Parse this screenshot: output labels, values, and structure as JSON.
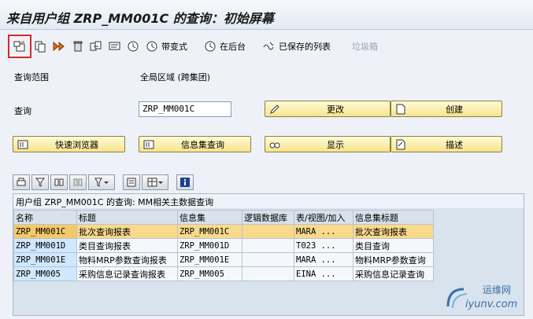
{
  "window": {
    "title": "来自用户组 ZRP_MM001C 的查询：初始屏幕"
  },
  "toolbar": {
    "items": [
      {
        "icon": "new-window-icon"
      },
      {
        "icon": "copy-icon"
      },
      {
        "icon": "execute-icon"
      },
      {
        "icon": "delete-icon"
      },
      {
        "icon": "copy-objects-icon"
      },
      {
        "icon": "description-icon"
      },
      {
        "icon": "execute-clock-icon"
      },
      {
        "icon": "variant-clock-icon",
        "label": "带变式"
      },
      {
        "icon": "background-clock-icon",
        "label": "在后台"
      },
      {
        "icon": "saved-lists-icon",
        "label": "已保存的列表"
      },
      {
        "label": "垃圾箱",
        "disabled": true
      }
    ]
  },
  "form": {
    "query_area_label": "查询范围",
    "query_area_value": "全局区域 (跨集团)",
    "query_label": "查询",
    "query_value": "ZRP_MM001C"
  },
  "buttons": {
    "change": "更改",
    "create": "创建",
    "quick_viewer": "快速浏览器",
    "infoset_query": "信息集查询",
    "display": "显示",
    "description": "描述"
  },
  "grid": {
    "caption": "用户组 ZRP_MM001C 的查询: MM相关主数据查询",
    "columns": [
      "名称",
      "标题",
      "信息集",
      "逻辑数据库",
      "表/视图/加入",
      "信息集标题"
    ],
    "rows": [
      [
        "ZRP_MM001C",
        "批次查询报表",
        "ZRP_MM001C",
        "",
        "MARA ...",
        "批次查询报表"
      ],
      [
        "ZRP_MM001D",
        "类目查询报表",
        "ZRP_MM001D",
        "",
        "T023 ...",
        "类目查询"
      ],
      [
        "ZRP_MM001E",
        "物料MRP参数查询报表",
        "ZRP_MM001E",
        "",
        "MARA ...",
        "物料MRP参数查询"
      ],
      [
        "ZRP_MM005",
        "采购信息记录查询报表",
        "ZRP_MM005",
        "",
        "EINA ...",
        "采购信息记录查询"
      ]
    ],
    "selected_row": 0
  },
  "watermark": {
    "line1": "运维网",
    "line2": "iyunv.com"
  }
}
